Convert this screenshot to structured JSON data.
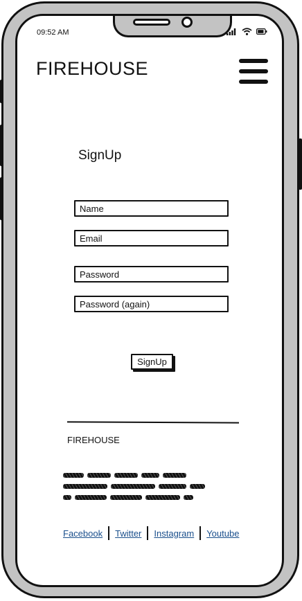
{
  "status_bar": {
    "time": "09:52 AM",
    "icons": [
      "signal-icon",
      "wifi-icon",
      "battery-icon"
    ]
  },
  "header": {
    "brand": "FIREHOUSE",
    "menu_icon": "hamburger-menu-icon"
  },
  "form": {
    "title": "SignUp",
    "fields": {
      "name": {
        "placeholder": "Name",
        "value": ""
      },
      "email": {
        "placeholder": "Email",
        "value": ""
      },
      "password": {
        "placeholder": "Password",
        "value": ""
      },
      "password_again": {
        "placeholder": "Password (again)",
        "value": ""
      }
    },
    "submit_label": "SignUp"
  },
  "footer": {
    "brand": "FIREHOUSE",
    "links": {
      "facebook": "Facebook",
      "twitter": "Twitter",
      "instagram": "Instagram",
      "youtube": "Youtube"
    },
    "link_color": "#1a4f8c"
  }
}
